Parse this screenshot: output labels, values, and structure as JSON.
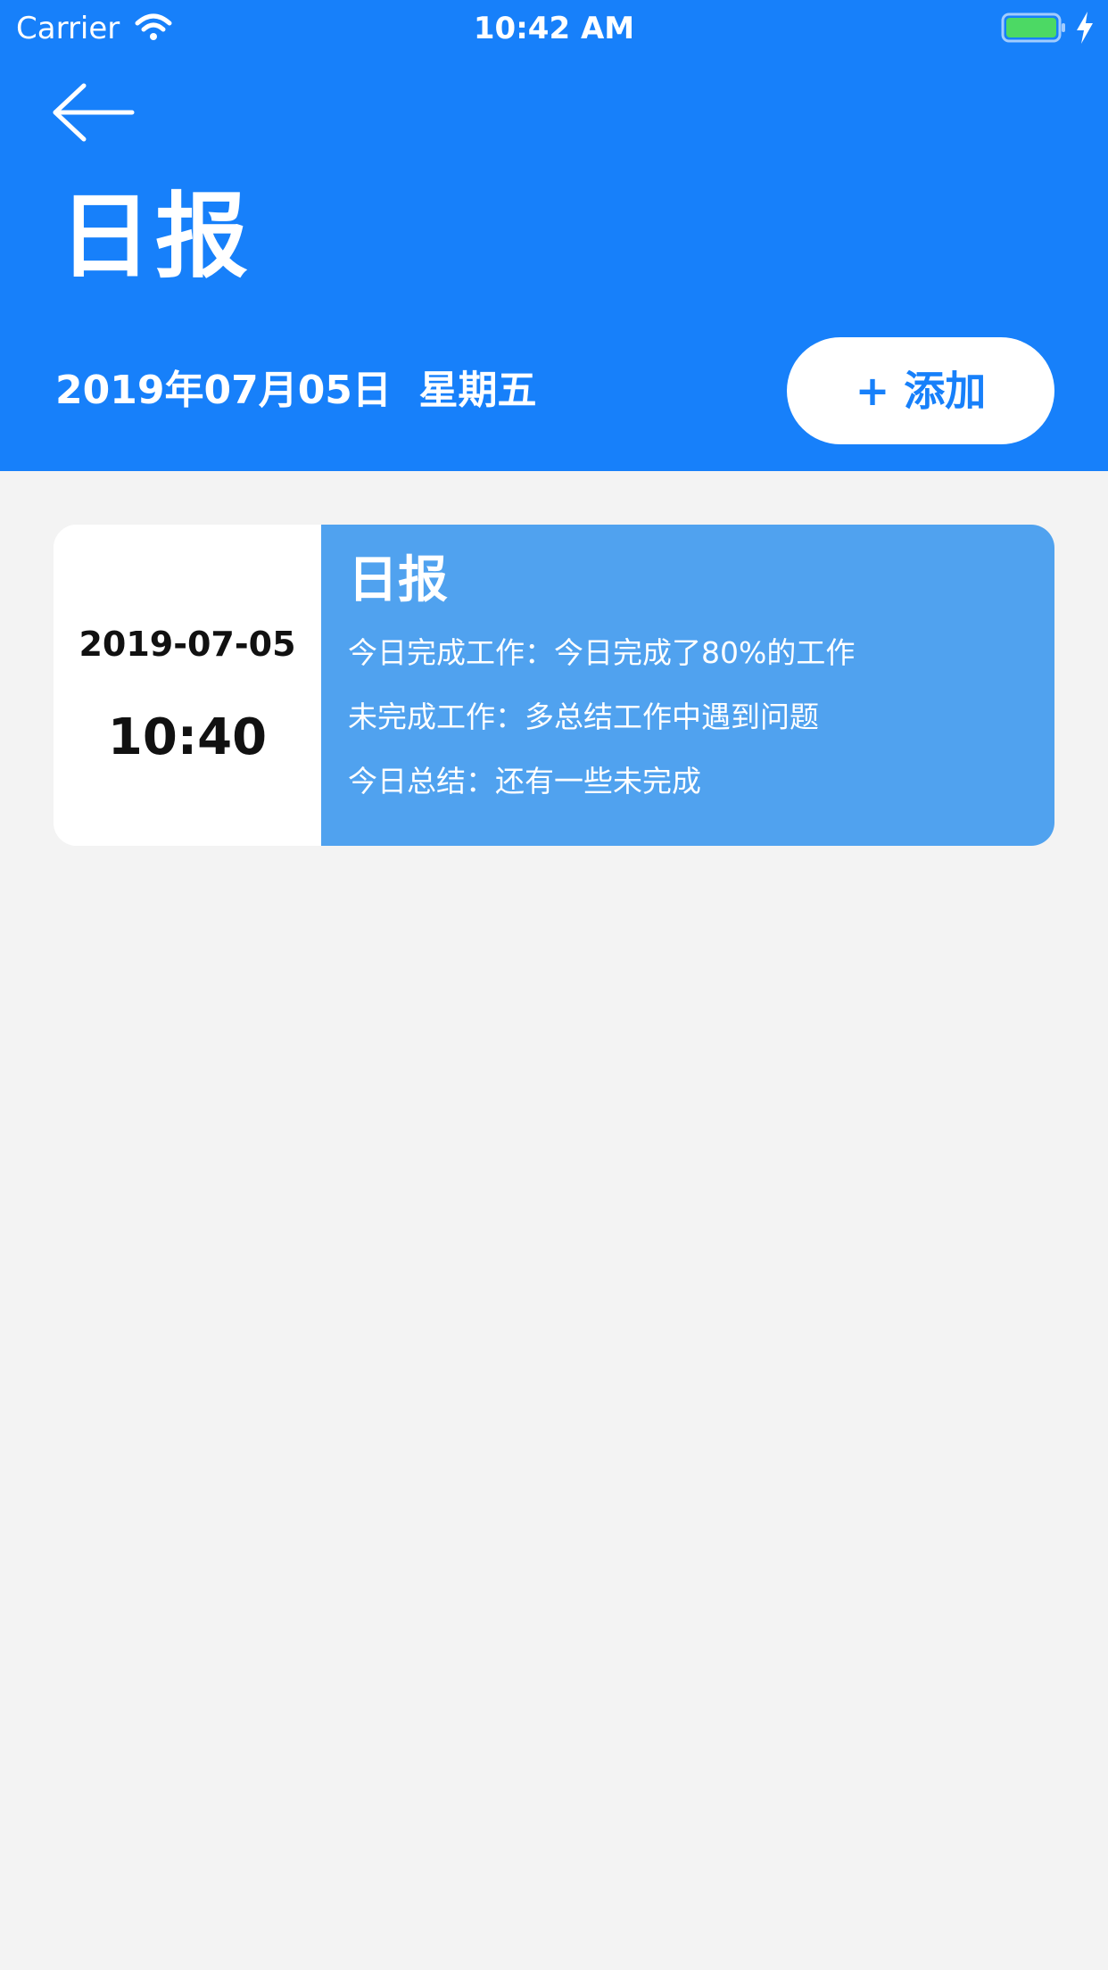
{
  "status_bar": {
    "carrier": "Carrier",
    "time": "10:42 AM",
    "battery_color": "#4cd964"
  },
  "header": {
    "title": "日报",
    "date_text": "2019年07月05日  星期五",
    "add_label": "+ 添加",
    "background": "#1780fa"
  },
  "report_card": {
    "date": "2019-07-05",
    "time": "10:40",
    "title": "日报",
    "lines": [
      "今日完成工作：今日完成了80%的工作",
      "未完成工作：多总结工作中遇到问题",
      "今日总结：还有一些未完成"
    ],
    "accent": "#50a2ef"
  },
  "icons": {
    "back": "back-arrow-icon",
    "wifi": "wifi-icon",
    "battery": "battery-icon",
    "charging": "charging-bolt-icon"
  }
}
